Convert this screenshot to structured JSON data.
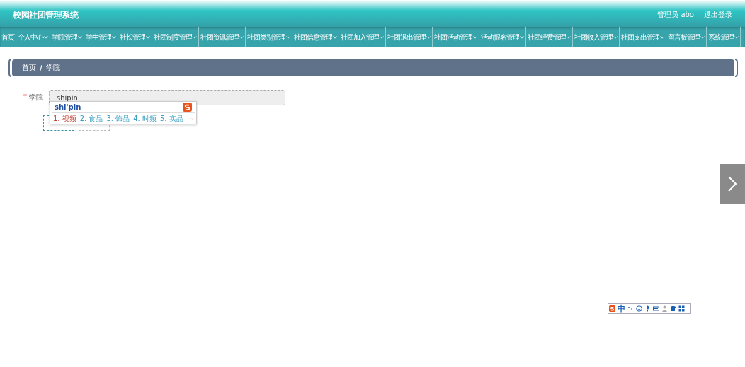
{
  "header": {
    "title": "校园社团管理系统",
    "user": "管理员 abo",
    "logout": "退出登录"
  },
  "nav": [
    {
      "label": "首页",
      "dropdown": false
    },
    {
      "label": "个人中心",
      "dropdown": true
    },
    {
      "label": "学院管理",
      "dropdown": true
    },
    {
      "label": "学生管理",
      "dropdown": true
    },
    {
      "label": "社长管理",
      "dropdown": true
    },
    {
      "label": "社团制度管理",
      "dropdown": true
    },
    {
      "label": "社团资讯管理",
      "dropdown": true
    },
    {
      "label": "社团类别管理",
      "dropdown": true
    },
    {
      "label": "社团信息管理",
      "dropdown": true
    },
    {
      "label": "社团加入管理",
      "dropdown": true
    },
    {
      "label": "社团退出管理",
      "dropdown": true
    },
    {
      "label": "社团活动管理",
      "dropdown": true
    },
    {
      "label": "活动报名管理",
      "dropdown": true
    },
    {
      "label": "社团经费管理",
      "dropdown": true
    },
    {
      "label": "社团收入管理",
      "dropdown": true
    },
    {
      "label": "社团支出管理",
      "dropdown": true
    },
    {
      "label": "留言板管理",
      "dropdown": true
    },
    {
      "label": "系统管理",
      "dropdown": true
    }
  ],
  "breadcrumb": [
    "首页",
    "/",
    "学院"
  ],
  "form": {
    "required_mark": "*",
    "label": "学院",
    "value": "shipin"
  },
  "ime": {
    "composition": "shi'pin",
    "candidates": [
      {
        "text": "1. 视频",
        "selected": true
      },
      {
        "text": "2. 食品",
        "selected": false
      },
      {
        "text": "3. 饰品",
        "selected": false
      },
      {
        "text": "4. 时频",
        "selected": false
      },
      {
        "text": "5. 实品",
        "selected": false
      }
    ]
  },
  "ime_toolbar": {
    "mode": "中"
  }
}
